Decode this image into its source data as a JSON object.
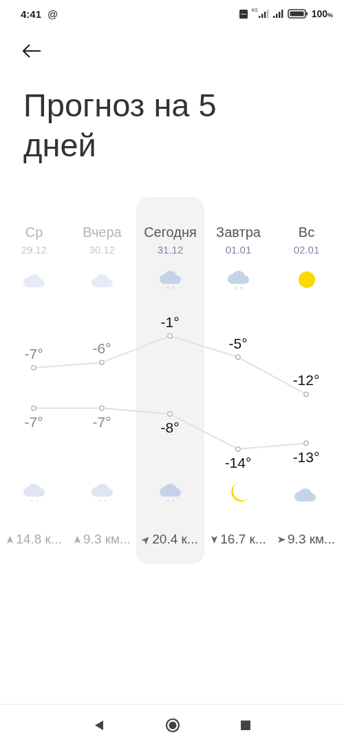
{
  "status_bar": {
    "time": "4:41",
    "notification": "@",
    "network": "4G",
    "battery": "100",
    "battery_unit": "%"
  },
  "title": "Прогноз на 5 дней",
  "days": [
    {
      "name": "Ср",
      "date": "29.12",
      "past": true,
      "selected": false,
      "day_icon": {
        "kind": "cloud"
      },
      "high": "-7°",
      "low": "-7°",
      "night_icon": {
        "kind": "snow"
      },
      "wind_arrow": {
        "kind": "north"
      },
      "wind": "14.8 к..."
    },
    {
      "name": "Вчера",
      "date": "30.12",
      "past": true,
      "selected": false,
      "day_icon": {
        "kind": "cloud"
      },
      "high": "-6°",
      "low": "-7°",
      "night_icon": {
        "kind": "snow"
      },
      "wind_arrow": {
        "kind": "north"
      },
      "wind": "9.3 км..."
    },
    {
      "name": "Сегодня",
      "date": "31.12",
      "past": false,
      "selected": true,
      "day_icon": {
        "kind": "snow"
      },
      "high": "-1°",
      "low": "-8°",
      "night_icon": {
        "kind": "snow"
      },
      "wind_arrow": {
        "kind": "northeast"
      },
      "wind": "20.4 к..."
    },
    {
      "name": "Завтра",
      "date": "01.01",
      "past": false,
      "selected": false,
      "day_icon": {
        "kind": "snow"
      },
      "high": "-5°",
      "low": "-14°",
      "night_icon": {
        "kind": "moon"
      },
      "wind_arrow": {
        "kind": "south"
      },
      "wind": "16.7 к..."
    },
    {
      "name": "Вс",
      "date": "02.01",
      "past": false,
      "selected": false,
      "day_icon": {
        "kind": "sun"
      },
      "high": "-12°",
      "low": "-13°",
      "night_icon": {
        "kind": "cloudmoon"
      },
      "wind_arrow": {
        "kind": "east"
      },
      "wind": "9.3 км..."
    }
  ]
}
